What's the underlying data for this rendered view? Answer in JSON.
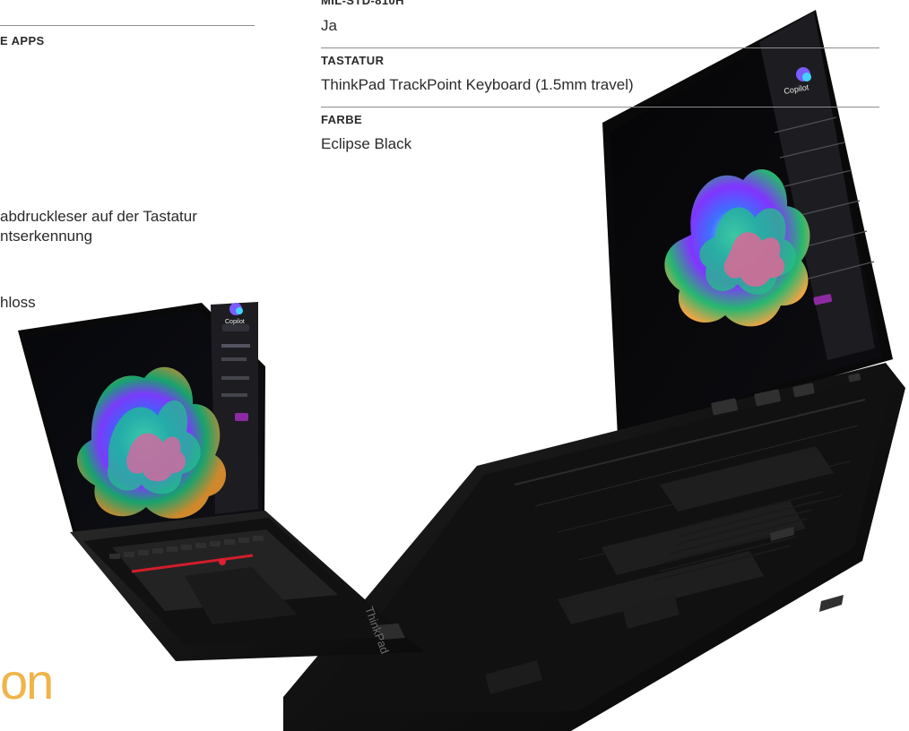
{
  "left_column": {
    "section_label": "E APPS",
    "feature_lines": [
      "abdruckleser auf der Tastatur",
      "ntserkennung"
    ],
    "feature_last": "hloss",
    "brand_fragment": "on"
  },
  "specs": [
    {
      "label": "MIL-STD-810H",
      "value": "Ja"
    },
    {
      "label": "TASTATUR",
      "value": "ThinkPad TrackPoint Keyboard (1.5mm travel)"
    },
    {
      "label": "FARBE",
      "value": "Eclipse Black"
    }
  ],
  "device": {
    "left_screen_app": "Copilot",
    "right_screen_app": "Copilot",
    "laptop_brand": "ThinkPad",
    "colors": {
      "accent": "#f0b44a",
      "laptop": "#161616",
      "screen_dark": "#1f1f24"
    }
  }
}
